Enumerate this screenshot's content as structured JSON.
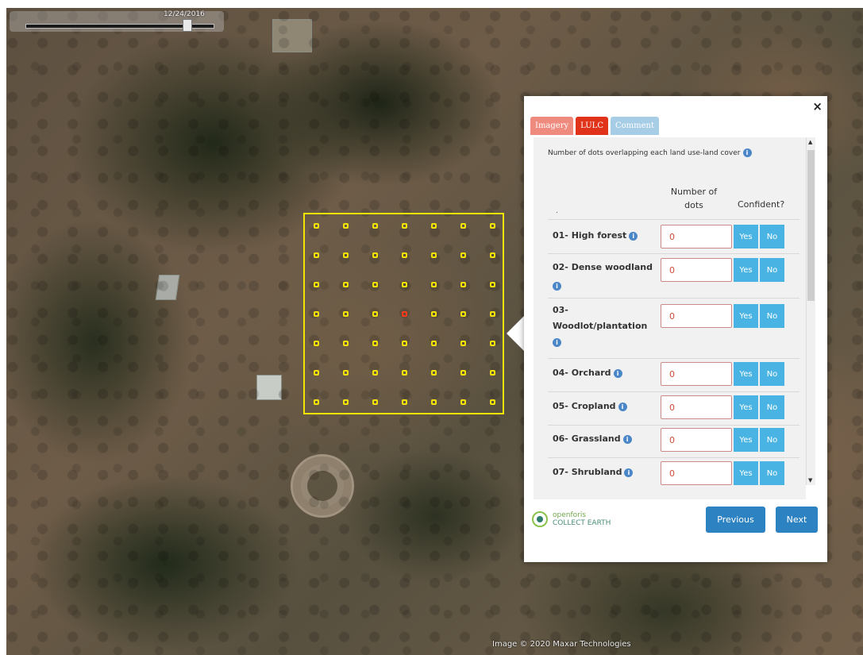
{
  "map": {
    "date": "12/24/2016",
    "credit": "Image © 2020 Maxar Technologies"
  },
  "panel": {
    "tabs": [
      {
        "label": "Imagery",
        "color": "#ef8a7e"
      },
      {
        "label": "LULC",
        "color": "#e0331a"
      },
      {
        "label": "Comment",
        "color": "#a7cde6"
      }
    ],
    "intro": "Number of dots overlapping each land use-land cover",
    "header_blank": ".",
    "header_number": "Number of dots",
    "header_confident": "Confident?",
    "yes": "Yes",
    "no": "No",
    "rows": [
      {
        "label": "01- High forest",
        "value": "0"
      },
      {
        "label": "02- Dense woodland",
        "value": "0"
      },
      {
        "label": "03- Woodlot/plantation",
        "value": "0"
      },
      {
        "label": "04- Orchard",
        "value": "0"
      },
      {
        "label": "05- Cropland",
        "value": "0"
      },
      {
        "label": "06- Grassland",
        "value": "0"
      },
      {
        "label": "07- Shrubland",
        "value": "0"
      }
    ],
    "buttons": {
      "previous": "Previous",
      "next": "Next"
    },
    "logo": {
      "top": "openforis",
      "bottom": "COLLECT EARTH"
    },
    "close": "×"
  },
  "icons": [
    "close-icon",
    "info-icon",
    "scroll-up-icon",
    "scroll-down-icon",
    "openforis-logo"
  ],
  "colors": {
    "grid": "#f2e400",
    "selected_dot": "#ff3a1a",
    "yes_no": "#49b4e4",
    "nav_button": "#2d82c1"
  },
  "grid": {
    "rows": 7,
    "cols": 7,
    "selected": [
      3,
      3
    ]
  }
}
